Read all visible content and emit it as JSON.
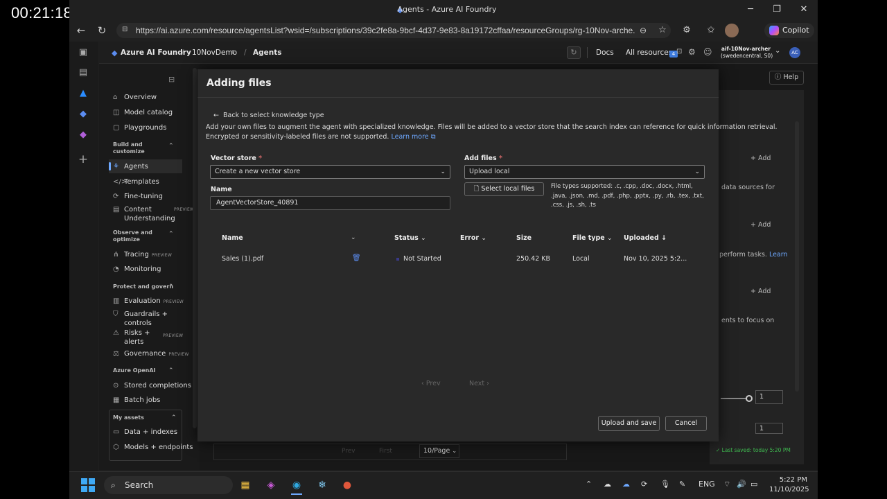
{
  "timestamp": "00:21:18.000",
  "window": {
    "title": "Agents - Azure AI Foundry",
    "minimize": "─",
    "restore": "❐",
    "close": "✕"
  },
  "browser": {
    "url": "https://ai.azure.com/resource/agentsList?wsid=/subscriptions/39c2fe8a-9bcf-4d37-9e83-8a19172cffaa/resourceGroups/rg-10Nov-arche...",
    "copilot": "Copilot"
  },
  "header": {
    "brand": "Azure AI Foundry",
    "project": "10NovDemo",
    "page": "Agents",
    "docs": "Docs",
    "all_resources": "All resources",
    "notif_count": "4",
    "account_name": "aif-10Nov-archer",
    "account_region": "(swedencentral, S0)",
    "avatar": "AC",
    "help": "Help"
  },
  "sidebar": {
    "overview": "Overview",
    "model_catalog": "Model catalog",
    "playgrounds": "Playgrounds",
    "sec_build": "Build and customize",
    "agents": "Agents",
    "templates": "Templates",
    "fine_tuning": "Fine-tuning",
    "content_understanding": "Content Understanding",
    "preview": "PREVIEW",
    "sec_observe": "Observe and optimize",
    "tracing": "Tracing",
    "monitoring": "Monitoring",
    "sec_protect": "Protect and govern",
    "evaluation": "Evaluation",
    "guardrails": "Guardrails + controls",
    "risks": "Risks + alerts",
    "governance": "Governance",
    "sec_openai": "Azure OpenAI",
    "stored_completions": "Stored completions",
    "batch_jobs": "Batch jobs",
    "sec_assets": "My assets",
    "data_indexes": "Data + indexes",
    "models_endpoints": "Models + endpoints"
  },
  "background": {
    "add": "Add",
    "text1": "data sources for",
    "text2": "perform tasks.",
    "learn": "Learn",
    "text3": "ents to focus on",
    "slider_val": "1",
    "last_saved": "✓ Last saved: today 5:20 PM",
    "per_page": "10/Page",
    "prev": "Prev",
    "first": "First"
  },
  "dialog": {
    "title": "Adding files",
    "back": "Back to select knowledge type",
    "desc1": "Add your own files to augment the agent with specialized knowledge. Files will be added to a vector store that the search index can reference for quick information retrieval.",
    "desc2": "Encrypted or sensitivity-labeled files are not supported.",
    "learn_more": "Learn more",
    "vector_store_label": "Vector store",
    "vector_store_value": "Create a new vector store",
    "add_files_label": "Add files",
    "add_files_value": "Upload local",
    "name_label": "Name",
    "name_value": "AgentVectorStore_40891",
    "select_local": "Select local files",
    "file_types": "File types supported: .c, .cpp, .doc, .docx, .html, .java, .json, .md, .pdf, .php, .pptx, .py, .rb, .tex, .txt, .css, .js, .sh, .ts",
    "columns": {
      "name": "Name",
      "status": "Status",
      "error": "Error",
      "size": "Size",
      "file_type": "File type",
      "uploaded": "Uploaded"
    },
    "rows": [
      {
        "name": "Sales (1).pdf",
        "status": "Not Started",
        "error": "",
        "size": "250.42 KB",
        "file_type": "Local",
        "uploaded": "Nov 10, 2025 5:2..."
      }
    ],
    "prev": "Prev",
    "next": "Next",
    "upload_save": "Upload and save",
    "cancel": "Cancel"
  },
  "taskbar": {
    "search": "Search",
    "lang": "ENG",
    "time": "5:22 PM",
    "date": "11/10/2025"
  }
}
